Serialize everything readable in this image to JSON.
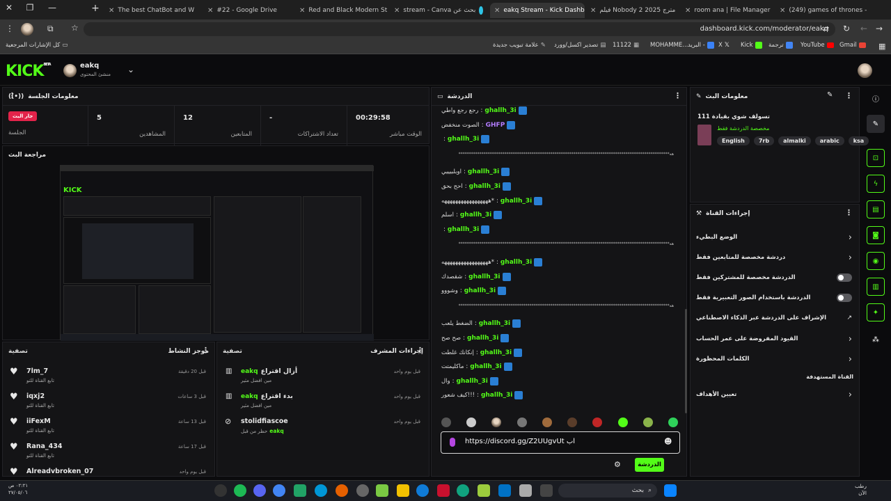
{
  "browser": {
    "tabs": [
      {
        "title": "The best ChatBot and W"
      },
      {
        "title": "#22 - Google Drive"
      },
      {
        "title": "Red and Black Modern St"
      },
      {
        "title": "stream - Canva بحث عن"
      },
      {
        "title": "eakq Stream - Kick Dashb"
      },
      {
        "title": "فيلم Nobody 2 2025 مترج"
      },
      {
        "title": "room ana | File Manager"
      },
      {
        "title": "(249) games of thrones -"
      }
    ],
    "url": "dashboard.kick.com/moderator/eakq",
    "bookmarks": {
      "all_bookmarks": "كل الإشارات المرجعية",
      "new_tab_mark": "علامة تبويب جديدة",
      "export": "تصدير اكسل/وورد",
      "num": "11122",
      "mohamme": "MOHAMME...",
      "mail": "البريد -",
      "x": "X",
      "kick": "Kick",
      "translate": "ترجمة",
      "youtube": "YouTube",
      "gmail": "Gmail"
    }
  },
  "header": {
    "logo": "KICK",
    "logo_beta": "BETA",
    "user": "eakq",
    "role": "منشئ المحتوى"
  },
  "session": {
    "title": "معلومات الجلسة",
    "live_badge": "جار البث",
    "live_label": "الجلسة",
    "stats": [
      {
        "value": "5",
        "label": "المشاهدين"
      },
      {
        "value": "12",
        "label": "المتابعين"
      },
      {
        "value": "-",
        "label": "تعداد الاشتراكات"
      },
      {
        "value": "00:29:58",
        "label": "الوقت مباشر"
      }
    ]
  },
  "preview": {
    "title": "مراجعة البث"
  },
  "activity": {
    "title": "موجز النشاط",
    "filter": "تصفية",
    "items": [
      {
        "name": "7lm_7",
        "sub": "تابع القناة للتو",
        "time": "قبل 20 دقيقة"
      },
      {
        "name": "iqxj2",
        "sub": "تابع القناة للتو",
        "time": "قبل 3 ساعات"
      },
      {
        "name": "iiFexM",
        "sub": "تابع القناة للتو",
        "time": "قبل 13 ساعة"
      },
      {
        "name": "Rana_434",
        "sub": "تابع القناة للتو",
        "time": "قبل 17 ساعة"
      },
      {
        "name": "Alreadvbroken_07",
        "sub": "",
        "time": "قبل يوم واحد"
      }
    ]
  },
  "modactions": {
    "title": "إجراءات المشرف",
    "filter": "تصفية",
    "items": [
      {
        "user": "eakq",
        "action": "أزال اقتراع",
        "sub": "مين افضل مثير",
        "time": "قبل يوم واحد"
      },
      {
        "user": "eakq",
        "action": "بدء اقتراع",
        "sub": "مين افضل مثير",
        "time": "قبل يوم واحد"
      },
      {
        "user": "stolidfiascoe",
        "action": "",
        "sub": "حظر من قبل",
        "sub_user": "eakq",
        "time": "قبل يوم واحد"
      }
    ]
  },
  "chat": {
    "title": "الدردشة",
    "lines": [
      {
        "kind": "msg",
        "user": "ghallh_3i",
        "text": "رجع رجع واطي",
        "color": "#53fc18"
      },
      {
        "kind": "msg",
        "user": "GHFP",
        "text": "الصوت منخفض",
        "color": "#b37cff"
      },
      {
        "kind": "msg",
        "user": "ghallh_3i",
        "text": "",
        "color": "#53fc18"
      },
      {
        "kind": "hash",
        "text": "*****************************************************************************************************هه"
      },
      {
        "kind": "msg",
        "user": "ghallh_3i",
        "text": "اوبلبيييي",
        "color": "#53fc18"
      },
      {
        "kind": "msg",
        "user": "ghallh_3i",
        "text": "احح بحق",
        "color": "#53fc18"
      },
      {
        "kind": "msg",
        "user": "ghallh_3i",
        "text": "*هههههههههههههههههه",
        "color": "#53fc18"
      },
      {
        "kind": "msg",
        "user": "ghallh_3i",
        "text": "اسلم",
        "color": "#53fc18"
      },
      {
        "kind": "msg",
        "user": "ghallh_3i",
        "text": "",
        "color": "#53fc18"
      },
      {
        "kind": "hash",
        "text": "*****************************************************************************************************هه"
      },
      {
        "kind": "msg",
        "user": "ghallh_3i",
        "text": "*هههههههههههههههههه",
        "color": "#53fc18"
      },
      {
        "kind": "msg",
        "user": "ghallh_3i",
        "text": "شقصدك",
        "color": "#53fc18"
      },
      {
        "kind": "msg",
        "user": "ghallh_3i",
        "text": "وشووو",
        "color": "#53fc18"
      },
      {
        "kind": "hash",
        "text": "*****************************************************************************************************هه"
      },
      {
        "kind": "msg",
        "user": "ghallh_3i",
        "text": "الضغط يلعب",
        "color": "#53fc18"
      },
      {
        "kind": "msg",
        "user": "ghallh_3i",
        "text": "صح صح",
        "color": "#53fc18"
      },
      {
        "kind": "msg",
        "user": "ghallh_3i",
        "text": "إنكانك غلطت",
        "color": "#53fc18"
      },
      {
        "kind": "msg",
        "user": "ghallh_3i",
        "text": "ماكليمتت",
        "color": "#53fc18"
      },
      {
        "kind": "msg",
        "user": "ghallh_3i",
        "text": "وال",
        "color": "#53fc18"
      },
      {
        "kind": "msg",
        "user": "ghallh_3i",
        "text": "!!!كيف شعور",
        "color": "#53fc18"
      }
    ],
    "input_value": "https://discord.gg/Z2UUgvUt اب",
    "send_label": "الدردشة"
  },
  "streaminfo": {
    "title": "معلومات البث",
    "stream_title": "تسولف شوي بقيادة 111",
    "category": "مخصصة الدردشة فقط",
    "tags": [
      "English",
      "7rb",
      "almalki",
      "arabic",
      "ksa"
    ]
  },
  "channelactions": {
    "title": "إجراءات القناة",
    "options": [
      {
        "label": "الوضع البطيء",
        "ctrl": "chevron"
      },
      {
        "label": "دردشة مخصصة للمتابعين فقط",
        "ctrl": "chevron"
      },
      {
        "label": "الدردشة مخصصة للمشتركين فقط",
        "ctrl": "toggle"
      },
      {
        "label": "الدردشة باستخدام الصور التعبيرية فقط",
        "ctrl": "toggle"
      },
      {
        "label": "الإشراف على الدردشة عبر الذكاء الاصطناعي",
        "ctrl": "external"
      },
      {
        "label": "القيود المفروضة على عمر الحساب",
        "ctrl": "chevron"
      },
      {
        "label": "الكلمات المحظورة",
        "ctrl": "chevron"
      }
    ],
    "subtitle": "القناة المستهدفة",
    "targets": "تعيين الأهداف"
  },
  "taskbar": {
    "search": "بحث",
    "time": "٠٢:٢١ ص",
    "date": "٢٧/٠٥/٠٦",
    "weather": "رطب",
    "weather2": "الآن"
  },
  "colors": {
    "accent": "#53fc18",
    "panel": "#141416",
    "bg": "#0b0b0d"
  }
}
